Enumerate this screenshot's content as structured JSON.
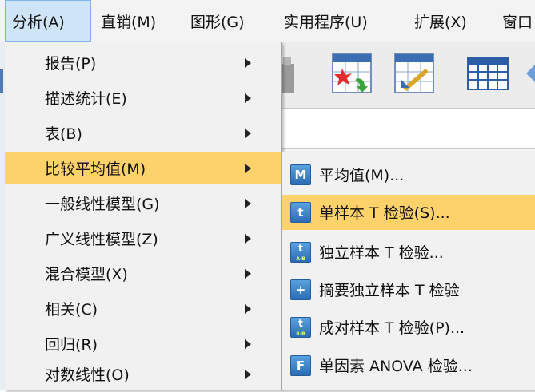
{
  "menubar": {
    "items": [
      {
        "label": "分析(A)",
        "active": true
      },
      {
        "label": "直销(M)"
      },
      {
        "label": "图形(G)"
      },
      {
        "label": "实用程序(U)"
      },
      {
        "label": "扩展(X)"
      },
      {
        "label": "窗口"
      }
    ]
  },
  "analyze_menu": {
    "items": [
      {
        "label": "报告(P)"
      },
      {
        "label": "描述统计(E)"
      },
      {
        "label": "表(B)"
      },
      {
        "label": "比较平均值(M)",
        "highlighted": true
      },
      {
        "label": "一般线性模型(G)"
      },
      {
        "label": "广义线性模型(Z)"
      },
      {
        "label": "混合模型(X)"
      },
      {
        "label": "相关(C)"
      },
      {
        "label": "回归(R)"
      },
      {
        "label": "对数线性(O)"
      }
    ]
  },
  "compare_means_submenu": {
    "items": [
      {
        "label": "平均值(M)...",
        "icon": "means-icon",
        "icon_text": "M"
      },
      {
        "label": "单样本 T 检验(S)...",
        "icon": "one-sample-t-icon",
        "icon_text": "t",
        "highlighted": true
      },
      {
        "label": "独立样本 T 检验...",
        "icon": "independent-t-icon",
        "icon_text": "t"
      },
      {
        "label": "摘要独立样本 T 检验",
        "icon": "summary-t-icon",
        "icon_text": "+"
      },
      {
        "label": "成对样本 T 检验(P)...",
        "icon": "paired-t-icon",
        "icon_text": "t"
      },
      {
        "label": "单因素 ANOVA 检验...",
        "icon": "anova-icon",
        "icon_text": "F"
      }
    ]
  },
  "colors": {
    "highlight": "#fdd26a",
    "menu_background": "#f1f1f1",
    "active_menubar": "#cfe4f7",
    "icon_blue": "#2b6cb5"
  }
}
